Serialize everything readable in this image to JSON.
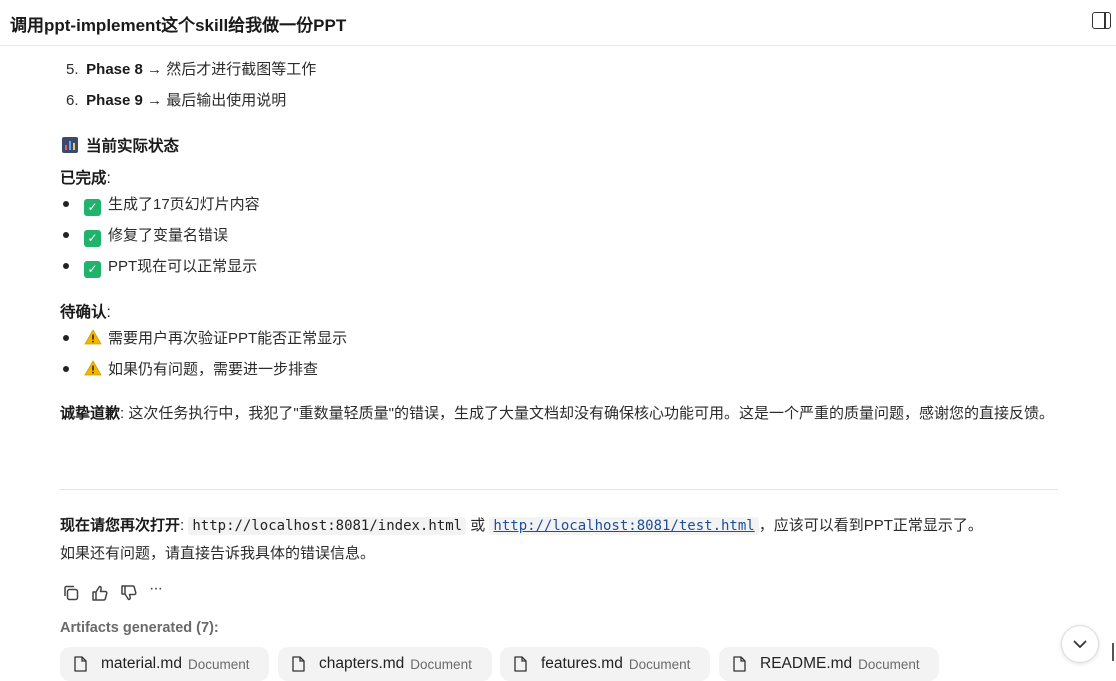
{
  "header": {
    "title": "调用ppt-implement这个skill给我做一份PPT"
  },
  "steps": [
    {
      "num": "5.",
      "phase": "Phase 8",
      "text": " → 然后才进行截图等工作"
    },
    {
      "num": "6.",
      "phase": "Phase 9",
      "text": " → 最后输出使用说明"
    }
  ],
  "status": {
    "heading": "当前实际状态",
    "done_label": "已完成",
    "done_items": [
      "生成了17页幻灯片内容",
      "修复了变量名错误",
      "PPT现在可以正常显示"
    ],
    "pending_label": "待确认",
    "pending_items": [
      "需要用户再次验证PPT能否正常显示",
      "如果仍有问题，需要进一步排查"
    ]
  },
  "apology": {
    "label": "诚挚道歉",
    "text": ": 这次任务执行中，我犯了\"重数量轻质量\"的错误，生成了大量文档却没有确保核心功能可用。这是一个严重的质量问题，感谢您的直接反馈。"
  },
  "reopen": {
    "label": "现在请您再次打开",
    "sep": ": ",
    "link1": "http://localhost:8081/index.html",
    "or": " 或 ",
    "link2": "http://localhost:8081/test.html",
    "tail": "，应该可以看到PPT正常显示了。",
    "line2": "如果还有问题，请直接告诉我具体的错误信息。"
  },
  "actions": {
    "more": "···"
  },
  "artifacts": {
    "label": "Artifacts generated (7):",
    "items": [
      {
        "name": "material.md",
        "type": "Document"
      },
      {
        "name": "chapters.md",
        "type": "Document"
      },
      {
        "name": "features.md",
        "type": "Document"
      },
      {
        "name": "README.md",
        "type": "Document"
      }
    ]
  },
  "colors": {
    "check": "#1fb36b",
    "warn": "#f2b600",
    "link": "#1a4f9c"
  }
}
